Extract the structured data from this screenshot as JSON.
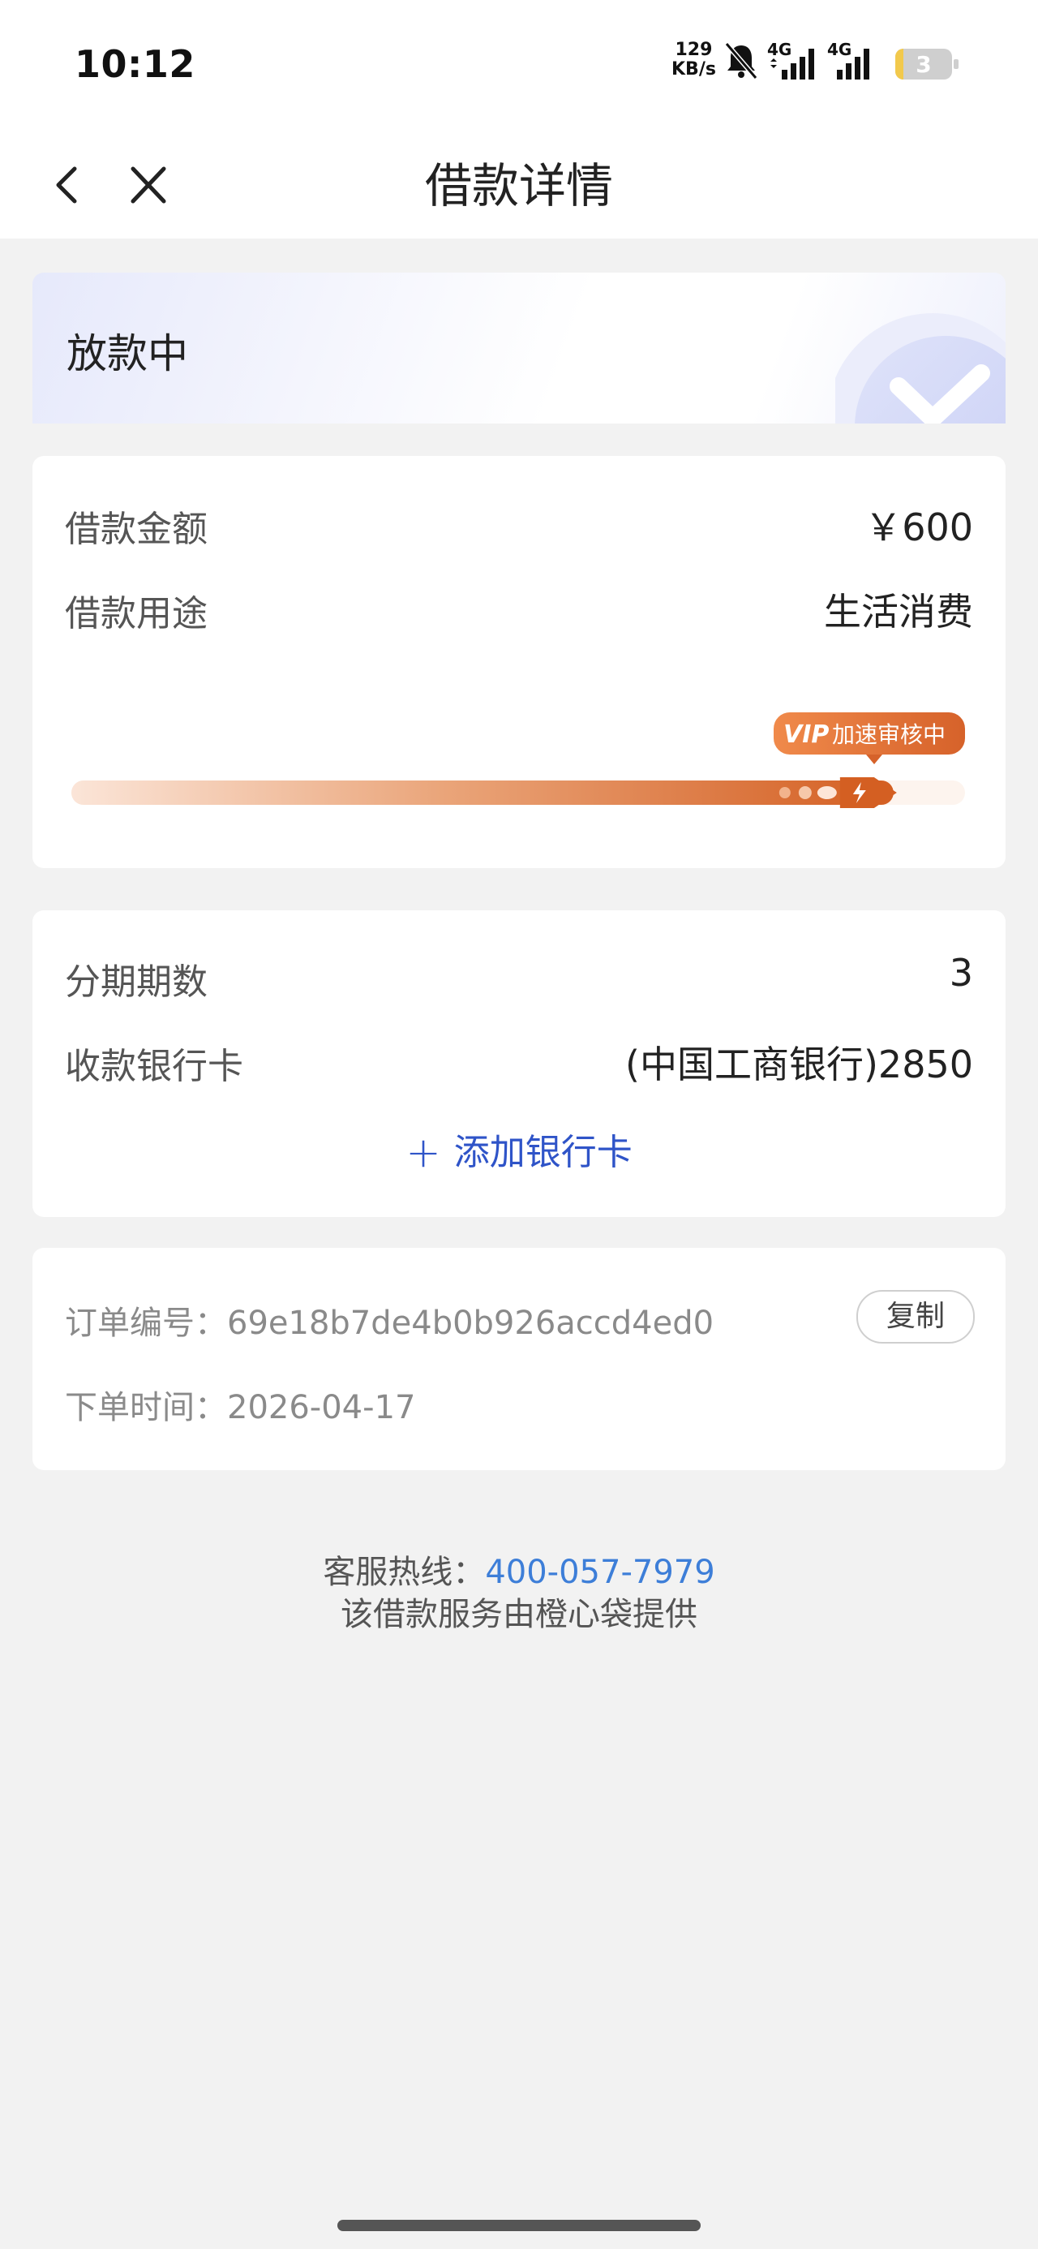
{
  "status_bar": {
    "time": "10:12",
    "net_speed_value": "129",
    "net_speed_unit": "KB/s",
    "signal_1_label": "4G",
    "signal_2_label": "4G",
    "battery_level": "3",
    "icons": [
      "mute-bell-icon",
      "signal-4g-icon",
      "signal-4g-icon",
      "battery-icon"
    ]
  },
  "nav": {
    "title": "借款详情",
    "icons": [
      "back-chevron-icon",
      "close-icon"
    ]
  },
  "status_card": {
    "status_text": "放款中",
    "icon": "check-circle-icon"
  },
  "loan": {
    "amount_label": "借款金额",
    "amount_value": "￥600",
    "purpose_label": "借款用途",
    "purpose_value": "生活消费",
    "progress": {
      "badge_vip": "VIP",
      "badge_text": "加速审核中",
      "fraction": 0.92,
      "icon": "lightning-rocket-icon"
    }
  },
  "installment": {
    "periods_label": "分期期数",
    "periods_value": "3",
    "bank_label": "收款银行卡",
    "bank_value": "(中国工商银行)2850",
    "add_card_plus": "+",
    "add_card_label": "添加银行卡"
  },
  "order": {
    "number_label": "订单编号：",
    "number_value": "69e18b7de4b0b926accd4ed0",
    "copy_label": "复制",
    "time_label": "下单时间：",
    "time_value": "2026-04-17"
  },
  "footer": {
    "hotline_label": "客服热线：",
    "hotline_number": "400-057-7979",
    "provider_text": "该借款服务由橙心袋提供"
  },
  "colors": {
    "accent_blue": "#2f54c8",
    "phone_blue": "#3d7ed8",
    "progress_orange": "#d9682a",
    "background": "#f2f2f2"
  }
}
